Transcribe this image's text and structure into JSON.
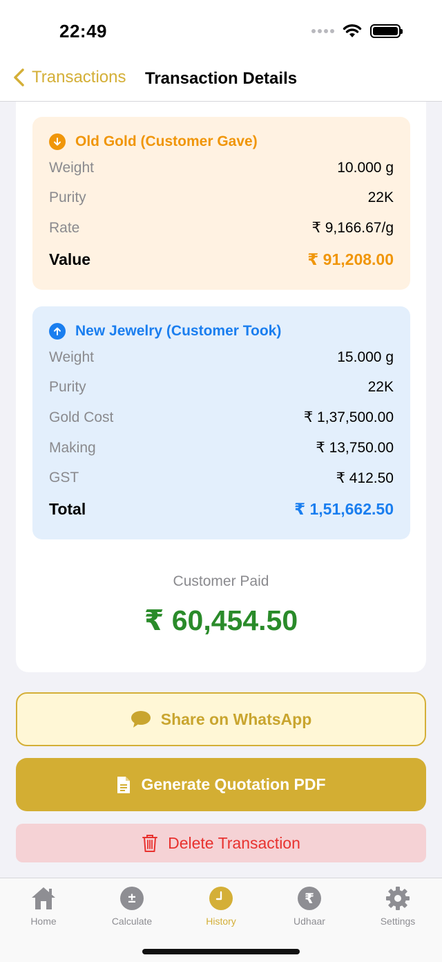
{
  "status_bar": {
    "time": "22:49"
  },
  "nav": {
    "back_label": "Transactions",
    "title": "Transaction Details"
  },
  "old_gold": {
    "title": "Old Gold (Customer Gave)",
    "rows": [
      {
        "label": "Weight",
        "value": "10.000 g"
      },
      {
        "label": "Purity",
        "value": "22K"
      },
      {
        "label": "Rate",
        "value": "₹ 9,166.67/g"
      }
    ],
    "total_label": "Value",
    "total_value": "₹ 91,208.00"
  },
  "new_jewelry": {
    "title": "New Jewelry (Customer Took)",
    "rows": [
      {
        "label": "Weight",
        "value": "15.000 g"
      },
      {
        "label": "Purity",
        "value": "22K"
      },
      {
        "label": "Gold Cost",
        "value": "₹ 1,37,500.00"
      },
      {
        "label": "Making",
        "value": "₹ 13,750.00"
      },
      {
        "label": "GST",
        "value": "₹ 412.50"
      }
    ],
    "total_label": "Total",
    "total_value": "₹ 1,51,662.50"
  },
  "summary": {
    "paid_label": "Customer Paid",
    "paid_amount": "₹ 60,454.50"
  },
  "actions": {
    "whatsapp_label": "Share on WhatsApp",
    "pdf_label": "Generate Quotation PDF",
    "delete_label": "Delete Transaction"
  },
  "tabs": [
    {
      "label": "Home",
      "icon": "house-icon"
    },
    {
      "label": "Calculate",
      "icon": "plus-minus-icon"
    },
    {
      "label": "History",
      "icon": "clock-icon",
      "active": true
    },
    {
      "label": "Udhaar",
      "icon": "rupee-icon"
    },
    {
      "label": "Settings",
      "icon": "gear-icon"
    }
  ],
  "colors": {
    "accent_gold": "#D4AF37",
    "old_gold_orange": "#F0960A",
    "new_jewelry_blue": "#1A7EEF",
    "paid_green": "#2A8B2A",
    "delete_red": "#E8322F"
  },
  "coin_glyphs": {
    "calculate": "±",
    "udhaar": "₹"
  }
}
